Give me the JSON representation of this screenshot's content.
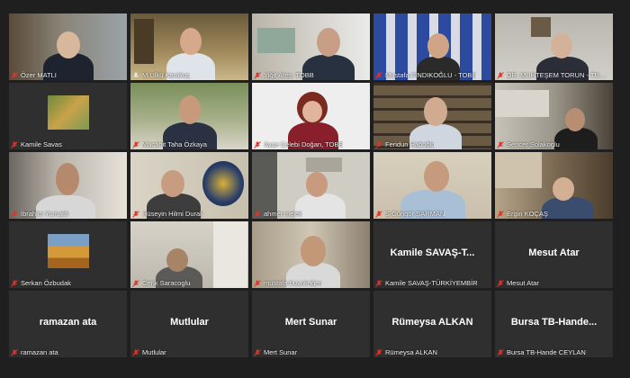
{
  "participants": [
    {
      "name": "Özer MATLI"
    },
    {
      "name": "M.Ülkü Karakuş"
    },
    {
      "name": "Yiğit Ateş- TOBB"
    },
    {
      "name": "Mustafa FINDIKOĞLU - TOBB"
    },
    {
      "name": "DR. MUHTEŞEM TORUN - TÜRKTOB G..."
    },
    {
      "name": "Kamile Savas"
    },
    {
      "name": "Macahit Taha Özkaya"
    },
    {
      "name": "Ayşe Çelebi Doğan, TOBB"
    },
    {
      "name": "Feridun Haboğlu"
    },
    {
      "name": "Sencer Solakoglu"
    },
    {
      "name": "İbrahim Yumaklı"
    },
    {
      "name": "Hüseyin Hilmi Durak"
    },
    {
      "name": "ahmet melek"
    },
    {
      "name": "S.Güngör ŞARMAN"
    },
    {
      "name": "Ergin KOÇAŞ"
    },
    {
      "name": "Serkan Özbudak"
    },
    {
      "name": "Cenk Saracoglu"
    },
    {
      "name": "mustafa buyukeğen"
    },
    {
      "name": "Kamile SAVAŞ-TÜRKİYEMBİR",
      "center": "Kamile SAVAŞ-T..."
    },
    {
      "name": "Mesut Atar",
      "center": "Mesut Atar"
    },
    {
      "name": "ramazan ata",
      "center": "ramazan ata"
    },
    {
      "name": "Mutlular",
      "center": "Mutlular"
    },
    {
      "name": "Mert Sunar",
      "center": "Mert Sunar"
    },
    {
      "name": "Rümeysa ALKAN",
      "center": "Rümeysa ALKAN"
    },
    {
      "name": "Bursa TB-Hande CEYLAN",
      "center": "Bursa TB-Hande..."
    }
  ],
  "colors": {
    "muted_mic": "#e0332a",
    "active_speaker": "#e5d642",
    "tile_bg": "#2f2f2f"
  }
}
